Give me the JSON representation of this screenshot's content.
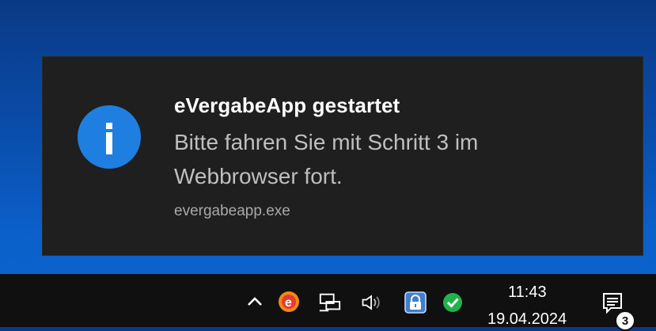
{
  "toast": {
    "title": "eVergabeApp gestartet",
    "body_line1": "Bitte fahren Sie mit Schritt 3 im",
    "body_line2": "Webbrowser fort.",
    "source": "evergabeapp.exe",
    "icon": "info-icon"
  },
  "taskbar": {
    "tray_icons": [
      "chevron-up-icon",
      "evergabe-app-icon",
      "network-icon",
      "volume-icon",
      "lock-app-icon",
      "check-circle-icon"
    ],
    "clock": {
      "time": "11:43",
      "date": "19.04.2024"
    },
    "notifications": {
      "count": "3",
      "icon": "action-center-icon"
    }
  },
  "colors": {
    "desktop_top": "#0a3a86",
    "desktop_bottom": "#0c66d3",
    "toast_bg": "#1f1f1f",
    "info_blue": "#1f7fe0",
    "taskbar_bg": "#101010",
    "check_green": "#22b14c"
  }
}
